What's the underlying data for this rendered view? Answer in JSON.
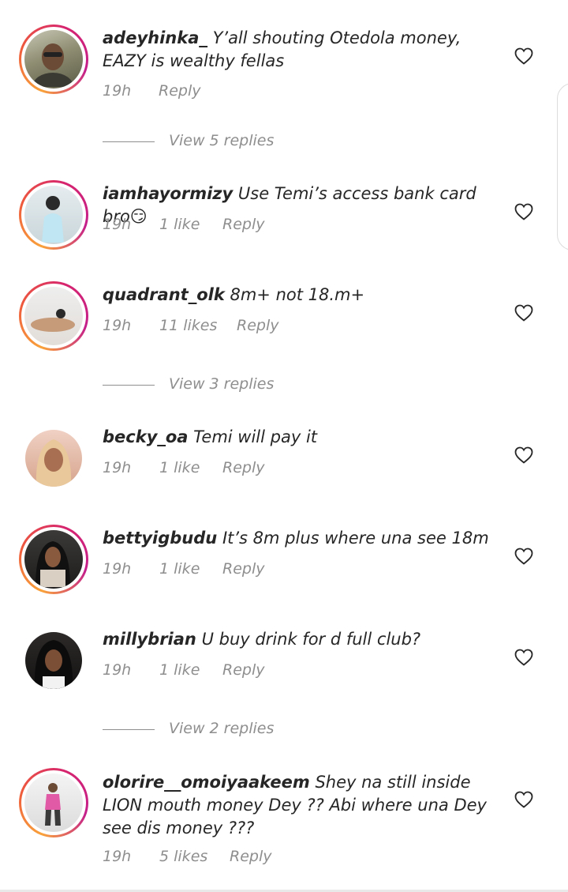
{
  "comments": [
    {
      "username": "adeyhinka_",
      "text": "Y’all shouting Otedola money, EAZY is wealthy fellas",
      "time": "19h",
      "likes": "",
      "reply": "Reply",
      "story_ring": true
    },
    {
      "username": "iamhayormizy",
      "text": "Use Temi’s access bank card bro😏",
      "time": "19h",
      "likes": "1 like",
      "reply": "Reply",
      "story_ring": true
    },
    {
      "username": "quadrant_olk",
      "text": "8m+ not 18.m+",
      "time": "19h",
      "likes": "11 likes",
      "reply": "Reply",
      "story_ring": true
    },
    {
      "username": "becky_oa",
      "text": "Temi will pay it",
      "time": "19h",
      "likes": "1 like",
      "reply": "Reply",
      "story_ring": false
    },
    {
      "username": "bettyigbudu",
      "text": "It’s 8m plus where una see 18m",
      "time": "19h",
      "likes": "1 like",
      "reply": "Reply",
      "story_ring": true
    },
    {
      "username": "millybrian",
      "text": "U buy drink for d full club?",
      "time": "19h",
      "likes": "1 like",
      "reply": "Reply",
      "story_ring": false
    },
    {
      "username": "olorire__omoiyaakeem",
      "text": "Shey na still inside LION mouth money Dey ?? Abi where una Dey see dis money ???",
      "time": "19h",
      "likes": "5 likes",
      "reply": "Reply",
      "story_ring": true
    }
  ],
  "view_replies": [
    "View 5 replies",
    "View 3 replies",
    "View 2 replies"
  ],
  "icons": {
    "like": "heart-outline-icon"
  },
  "colors": {
    "text": "#262626",
    "muted": "#8e8e8e",
    "ring_start": "#f9a23b",
    "ring_end": "#c41f8b"
  }
}
